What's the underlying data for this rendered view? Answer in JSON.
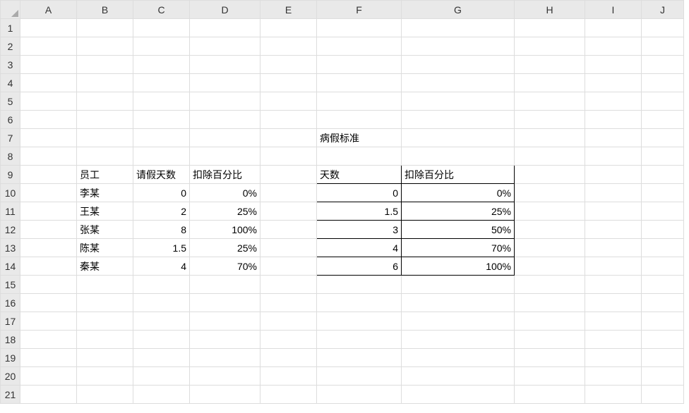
{
  "columns": [
    "A",
    "B",
    "C",
    "D",
    "E",
    "F",
    "G",
    "H",
    "I",
    "J"
  ],
  "rowCount": 21,
  "labels": {
    "F7": "病假标准",
    "B9": "员工",
    "C9": "请假天数",
    "D9": "扣除百分比",
    "F9": "天数",
    "G9": "扣除百分比"
  },
  "employees": [
    {
      "name": "李某",
      "days": "0",
      "pct": "0%"
    },
    {
      "name": "王某",
      "days": "2",
      "pct": "25%"
    },
    {
      "name": "张某",
      "days": "8",
      "pct": "100%"
    },
    {
      "name": "陈某",
      "days": "1.5",
      "pct": "25%"
    },
    {
      "name": "秦某",
      "days": "4",
      "pct": "70%"
    }
  ],
  "standard": [
    {
      "days": "0",
      "pct": "0%"
    },
    {
      "days": "1.5",
      "pct": "25%"
    },
    {
      "days": "3",
      "pct": "50%"
    },
    {
      "days": "4",
      "pct": "70%"
    },
    {
      "days": "6",
      "pct": "100%"
    }
  ]
}
